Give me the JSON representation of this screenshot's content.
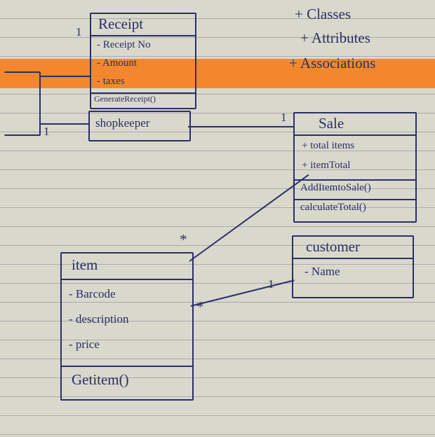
{
  "legend": {
    "l1": "+ Classes",
    "l2": "+ Attributes",
    "l3": "+ Associations"
  },
  "receipt": {
    "title": "Receipt",
    "a1": "- Receipt No",
    "a2": "- Amount",
    "a3": "- taxes",
    "m1": "GenerateReceipt()"
  },
  "shopkeeper": {
    "title": "shopkeeper"
  },
  "sale": {
    "title": "Sale",
    "a1": "+ total items",
    "a2": "+ itemTotal",
    "m1": "AddItemtoSale()",
    "m2": "calculateTotal()"
  },
  "customer": {
    "title": "customer",
    "a1": "- Name"
  },
  "item": {
    "title": "item",
    "a1": "- Barcode",
    "a2": "- description",
    "a3": "- price",
    "m1": "Getitem()"
  },
  "mult": {
    "one_a": "1",
    "one_b": "1",
    "one_c": "1",
    "one_d": "1",
    "star_a": "*",
    "star_b": "*"
  }
}
